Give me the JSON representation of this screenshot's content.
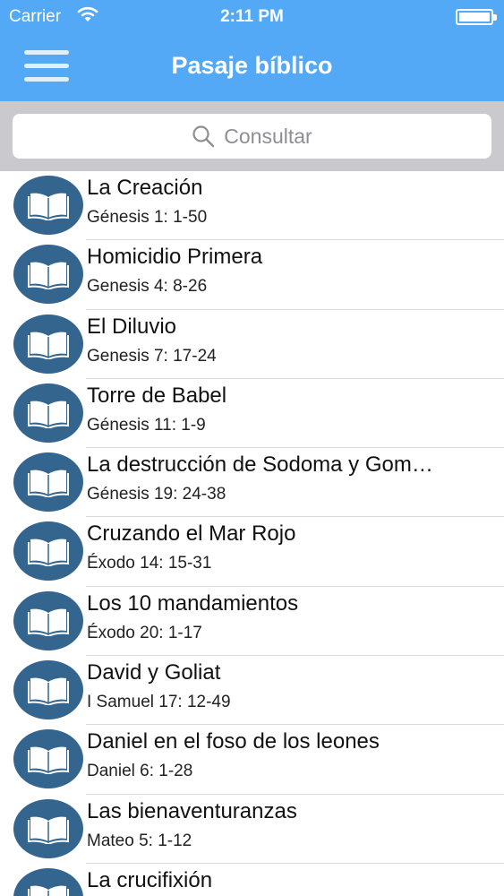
{
  "status_bar": {
    "carrier": "Carrier",
    "time": "2:11 PM"
  },
  "header": {
    "title": "Pasaje bíblico",
    "menu_icon": "hamburger-menu-icon"
  },
  "search": {
    "placeholder": "Consultar",
    "icon": "search-icon"
  },
  "colors": {
    "nav_bar": "#53a9f6",
    "icon_circle": "#33658f",
    "search_bar": "#c9c9ce"
  },
  "list": {
    "items": [
      {
        "title": "La Creación",
        "reference": "Génesis 1: 1-50"
      },
      {
        "title": "Homicidio Primera",
        "reference": "Genesis 4: 8-26"
      },
      {
        "title": "El Diluvio",
        "reference": "Genesis 7: 17-24"
      },
      {
        "title": "Torre de Babel",
        "reference": "Génesis 11: 1-9"
      },
      {
        "title": "La destrucción de Sodoma y Gom…",
        "reference": "Génesis 19: 24-38"
      },
      {
        "title": "Cruzando el Mar Rojo",
        "reference": "Éxodo 14: 15-31"
      },
      {
        "title": "Los 10 mandamientos",
        "reference": "Éxodo 20: 1-17"
      },
      {
        "title": "David y Goliat",
        "reference": "I Samuel 17: 12-49"
      },
      {
        "title": "Daniel en el foso de los leones",
        "reference": "Daniel 6: 1-28"
      },
      {
        "title": "Las bienaventuranzas",
        "reference": "Mateo 5: 1-12"
      },
      {
        "title": "La crucifixión",
        "reference": ""
      }
    ]
  }
}
